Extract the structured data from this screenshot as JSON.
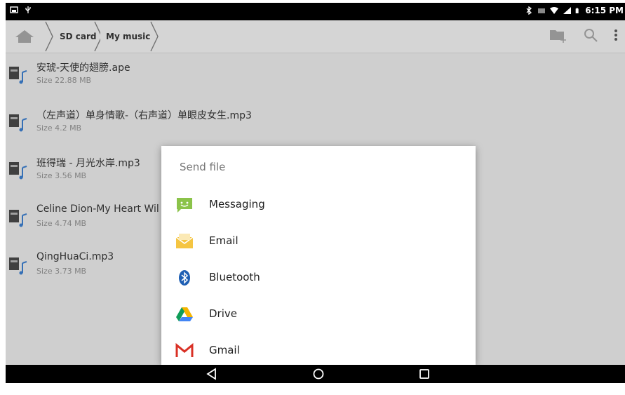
{
  "status_bar": {
    "time": "6:15 PM"
  },
  "breadcrumb": [
    {
      "label": "SD card"
    },
    {
      "label": "My music"
    }
  ],
  "files": [
    {
      "name": "安琥-天使的翅膀.ape",
      "size": "Size 22.88 MB"
    },
    {
      "name": "（左声道）单身情歌-（右声道）单眼皮女生.mp3",
      "size": "Size 4.2 MB"
    },
    {
      "name": "班得瑞 - 月光水岸.mp3",
      "size": "Size 3.56 MB"
    },
    {
      "name": "Celine Dion-My Heart Wil",
      "size": "Size 4.74 MB"
    },
    {
      "name": "QingHuaCi.mp3",
      "size": "Size 3.73 MB"
    }
  ],
  "dialog": {
    "title": "Send file",
    "apps": [
      {
        "label": "Messaging",
        "icon": "messaging-icon"
      },
      {
        "label": "Email",
        "icon": "email-icon"
      },
      {
        "label": "Bluetooth",
        "icon": "bluetooth-icon"
      },
      {
        "label": "Drive",
        "icon": "drive-icon"
      },
      {
        "label": "Gmail",
        "icon": "gmail-icon"
      }
    ]
  },
  "colors": {
    "messaging": "#8bc34a",
    "email": "#f5c542",
    "bluetooth": "#1e5fb4",
    "gmail": "#d93025"
  }
}
